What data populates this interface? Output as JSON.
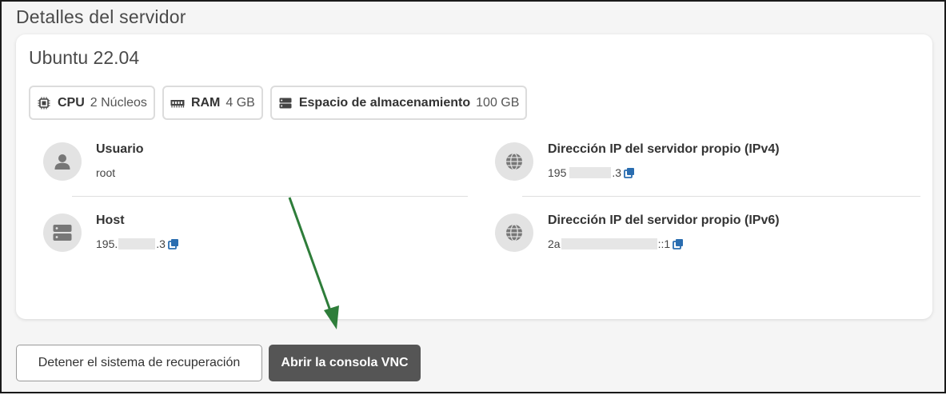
{
  "page": {
    "title": "Detalles del servidor"
  },
  "server": {
    "os": "Ubuntu 22.04",
    "specs": [
      {
        "icon": "cpu-icon",
        "label": "CPU",
        "value": "2 Núcleos"
      },
      {
        "icon": "ram-icon",
        "label": "RAM",
        "value": "4 GB"
      },
      {
        "icon": "storage-icon",
        "label": "Espacio de almacenamiento",
        "value": "100 GB"
      }
    ],
    "user": {
      "title": "Usuario",
      "value": "root",
      "icon": "user-icon"
    },
    "host": {
      "title": "Host",
      "prefix": "195.",
      "suffix": ".3",
      "icon": "server-icon"
    },
    "ipv4": {
      "title": "Dirección IP del servidor propio (IPv4)",
      "prefix": "195",
      "suffix": ".3",
      "icon": "globe-icon"
    },
    "ipv6": {
      "title": "Dirección IP del servidor propio (IPv6)",
      "prefix": "2a",
      "suffix": "::1",
      "icon": "globe-icon"
    }
  },
  "actions": {
    "stop_rescue": "Detener el sistema de recuperación",
    "open_vnc": "Abrir la consola VNC"
  },
  "colors": {
    "copy_icon": "#2a6db0",
    "annotation_arrow": "#2e7d3a",
    "dark_button": "#555555"
  }
}
